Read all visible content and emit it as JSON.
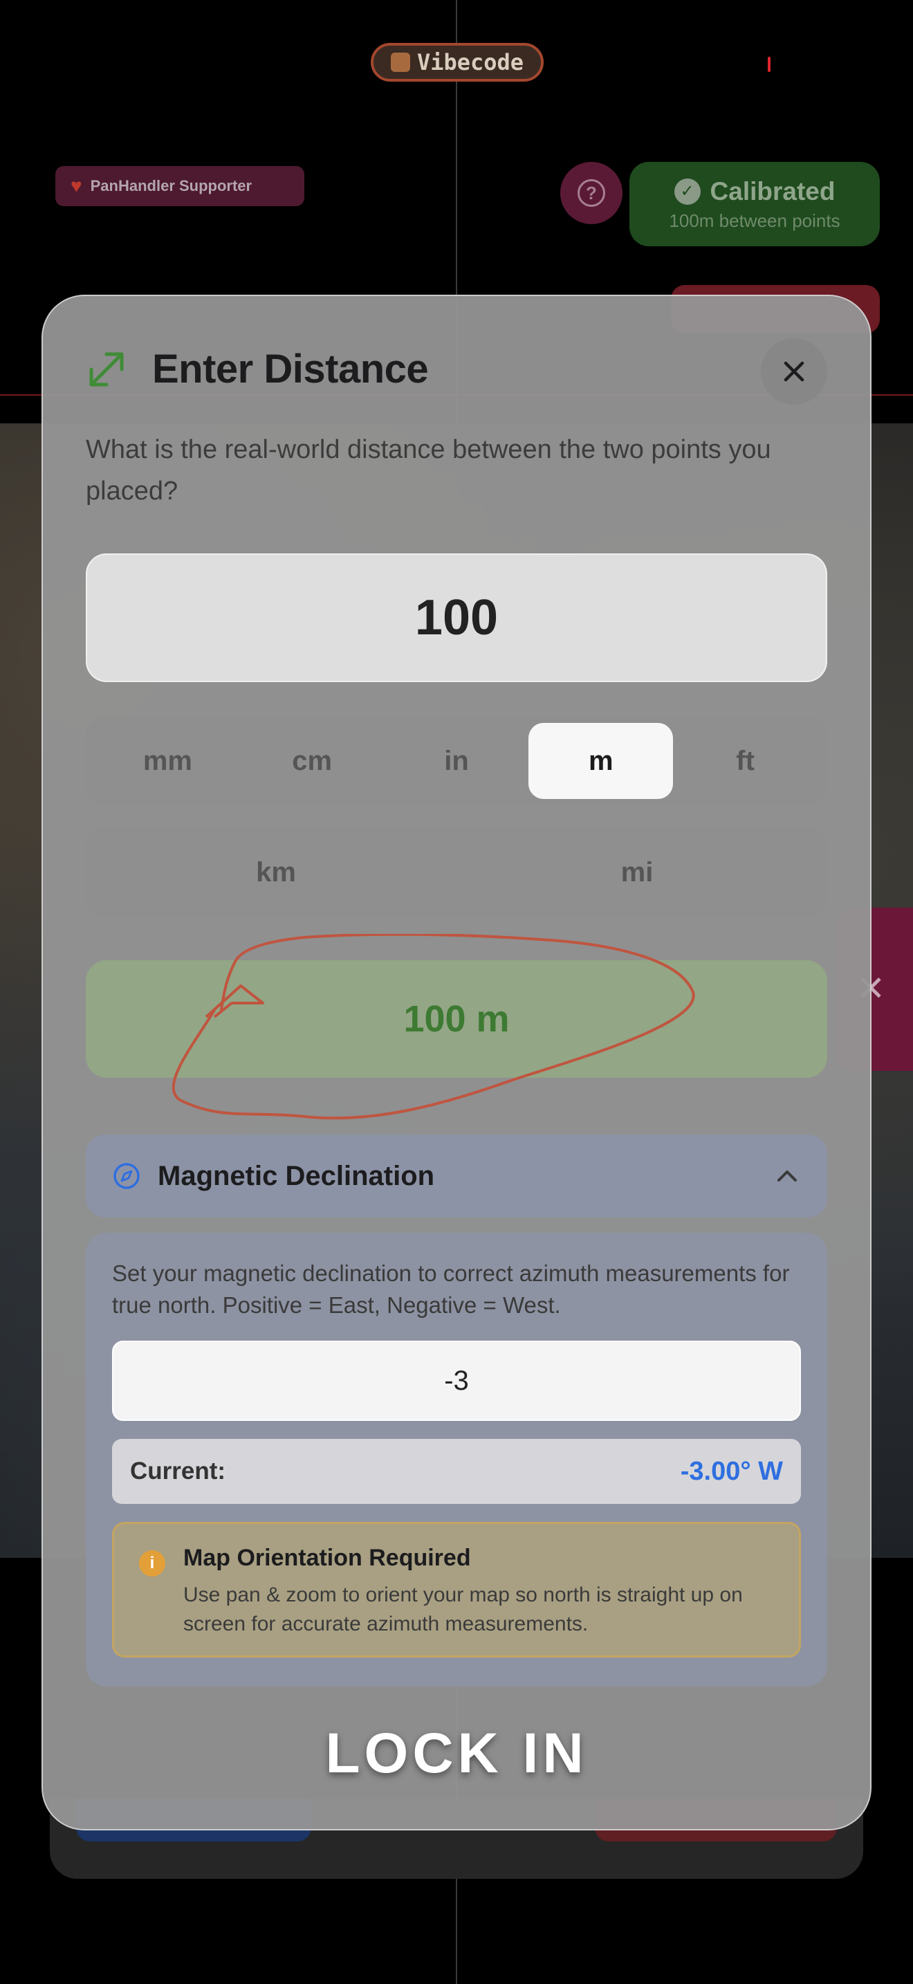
{
  "app": {
    "name": "Vibecode"
  },
  "supporter": {
    "label": "PanHandler Supporter"
  },
  "help": {
    "glyph": "?"
  },
  "calibration": {
    "status": "Calibrated",
    "detail": "100m between points"
  },
  "modal": {
    "title": "Enter Distance",
    "prompt": "What is the real-world distance between the two points you placed?",
    "distance_value": "100",
    "units_row1": [
      "mm",
      "cm",
      "in",
      "m",
      "ft"
    ],
    "units_row2": [
      "km",
      "mi"
    ],
    "selected_unit": "m",
    "result": "100 m",
    "declination": {
      "title": "Magnetic Declination",
      "expanded": true,
      "description": "Set your magnetic declination to correct azimuth measurements for true north. Positive = East, Negative = West.",
      "input_value": "-3",
      "current_label": "Current:",
      "current_value": "-3.00° W",
      "notice_title": "Map Orientation Required",
      "notice_text": "Use pan & zoom to orient your map so north is straight up on screen for accurate azimuth measurements.",
      "notice_icon": "info-icon"
    },
    "confirm_label": "LOCK IN"
  },
  "icons": {
    "expand": "expand-arrows-icon",
    "close": "close-icon",
    "compass": "compass-icon",
    "chevron": "chevron-up-icon",
    "check": "check-circle-icon",
    "heart": "heart-icon",
    "help": "question-circle-icon"
  },
  "colors": {
    "accent_green": "#3d7a32",
    "accent_blue": "#2f6fe0",
    "warning": "#e3a039",
    "scribble": "#c0553f"
  }
}
